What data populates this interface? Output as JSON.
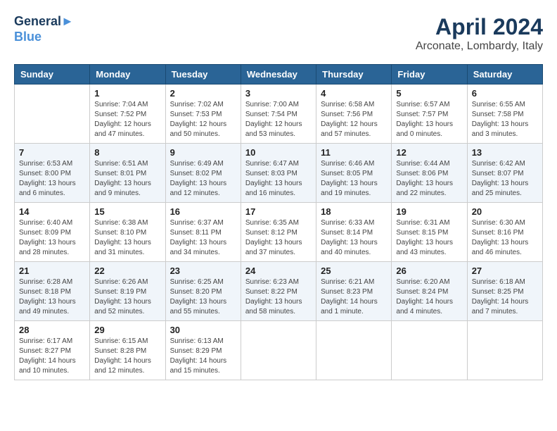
{
  "header": {
    "logo_line1": "General",
    "logo_line2": "Blue",
    "month_title": "April 2024",
    "location": "Arconate, Lombardy, Italy"
  },
  "days_of_week": [
    "Sunday",
    "Monday",
    "Tuesday",
    "Wednesday",
    "Thursday",
    "Friday",
    "Saturday"
  ],
  "weeks": [
    [
      {
        "day": "",
        "info": ""
      },
      {
        "day": "1",
        "info": "Sunrise: 7:04 AM\nSunset: 7:52 PM\nDaylight: 12 hours\nand 47 minutes."
      },
      {
        "day": "2",
        "info": "Sunrise: 7:02 AM\nSunset: 7:53 PM\nDaylight: 12 hours\nand 50 minutes."
      },
      {
        "day": "3",
        "info": "Sunrise: 7:00 AM\nSunset: 7:54 PM\nDaylight: 12 hours\nand 53 minutes."
      },
      {
        "day": "4",
        "info": "Sunrise: 6:58 AM\nSunset: 7:56 PM\nDaylight: 12 hours\nand 57 minutes."
      },
      {
        "day": "5",
        "info": "Sunrise: 6:57 AM\nSunset: 7:57 PM\nDaylight: 13 hours\nand 0 minutes."
      },
      {
        "day": "6",
        "info": "Sunrise: 6:55 AM\nSunset: 7:58 PM\nDaylight: 13 hours\nand 3 minutes."
      }
    ],
    [
      {
        "day": "7",
        "info": "Sunrise: 6:53 AM\nSunset: 8:00 PM\nDaylight: 13 hours\nand 6 minutes."
      },
      {
        "day": "8",
        "info": "Sunrise: 6:51 AM\nSunset: 8:01 PM\nDaylight: 13 hours\nand 9 minutes."
      },
      {
        "day": "9",
        "info": "Sunrise: 6:49 AM\nSunset: 8:02 PM\nDaylight: 13 hours\nand 12 minutes."
      },
      {
        "day": "10",
        "info": "Sunrise: 6:47 AM\nSunset: 8:03 PM\nDaylight: 13 hours\nand 16 minutes."
      },
      {
        "day": "11",
        "info": "Sunrise: 6:46 AM\nSunset: 8:05 PM\nDaylight: 13 hours\nand 19 minutes."
      },
      {
        "day": "12",
        "info": "Sunrise: 6:44 AM\nSunset: 8:06 PM\nDaylight: 13 hours\nand 22 minutes."
      },
      {
        "day": "13",
        "info": "Sunrise: 6:42 AM\nSunset: 8:07 PM\nDaylight: 13 hours\nand 25 minutes."
      }
    ],
    [
      {
        "day": "14",
        "info": "Sunrise: 6:40 AM\nSunset: 8:09 PM\nDaylight: 13 hours\nand 28 minutes."
      },
      {
        "day": "15",
        "info": "Sunrise: 6:38 AM\nSunset: 8:10 PM\nDaylight: 13 hours\nand 31 minutes."
      },
      {
        "day": "16",
        "info": "Sunrise: 6:37 AM\nSunset: 8:11 PM\nDaylight: 13 hours\nand 34 minutes."
      },
      {
        "day": "17",
        "info": "Sunrise: 6:35 AM\nSunset: 8:12 PM\nDaylight: 13 hours\nand 37 minutes."
      },
      {
        "day": "18",
        "info": "Sunrise: 6:33 AM\nSunset: 8:14 PM\nDaylight: 13 hours\nand 40 minutes."
      },
      {
        "day": "19",
        "info": "Sunrise: 6:31 AM\nSunset: 8:15 PM\nDaylight: 13 hours\nand 43 minutes."
      },
      {
        "day": "20",
        "info": "Sunrise: 6:30 AM\nSunset: 8:16 PM\nDaylight: 13 hours\nand 46 minutes."
      }
    ],
    [
      {
        "day": "21",
        "info": "Sunrise: 6:28 AM\nSunset: 8:18 PM\nDaylight: 13 hours\nand 49 minutes."
      },
      {
        "day": "22",
        "info": "Sunrise: 6:26 AM\nSunset: 8:19 PM\nDaylight: 13 hours\nand 52 minutes."
      },
      {
        "day": "23",
        "info": "Sunrise: 6:25 AM\nSunset: 8:20 PM\nDaylight: 13 hours\nand 55 minutes."
      },
      {
        "day": "24",
        "info": "Sunrise: 6:23 AM\nSunset: 8:22 PM\nDaylight: 13 hours\nand 58 minutes."
      },
      {
        "day": "25",
        "info": "Sunrise: 6:21 AM\nSunset: 8:23 PM\nDaylight: 14 hours\nand 1 minute."
      },
      {
        "day": "26",
        "info": "Sunrise: 6:20 AM\nSunset: 8:24 PM\nDaylight: 14 hours\nand 4 minutes."
      },
      {
        "day": "27",
        "info": "Sunrise: 6:18 AM\nSunset: 8:25 PM\nDaylight: 14 hours\nand 7 minutes."
      }
    ],
    [
      {
        "day": "28",
        "info": "Sunrise: 6:17 AM\nSunset: 8:27 PM\nDaylight: 14 hours\nand 10 minutes."
      },
      {
        "day": "29",
        "info": "Sunrise: 6:15 AM\nSunset: 8:28 PM\nDaylight: 14 hours\nand 12 minutes."
      },
      {
        "day": "30",
        "info": "Sunrise: 6:13 AM\nSunset: 8:29 PM\nDaylight: 14 hours\nand 15 minutes."
      },
      {
        "day": "",
        "info": ""
      },
      {
        "day": "",
        "info": ""
      },
      {
        "day": "",
        "info": ""
      },
      {
        "day": "",
        "info": ""
      }
    ]
  ]
}
